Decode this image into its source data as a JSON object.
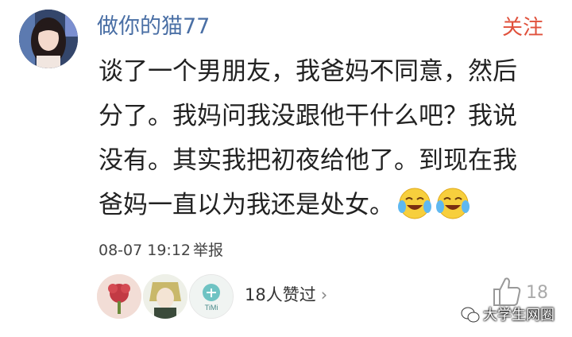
{
  "comment": {
    "username": "做你的猫77",
    "follow_label": "关注",
    "text_lines": [
      "谈了一个男朋友，我爸妈不同意，然后",
      "分了。我妈问我没跟他干什么吧？我说",
      "没有。其实我把初夜给他了。到现在我",
      "爸妈一直以为我还是处女。"
    ],
    "emojis": [
      "laughing-crying-emoji",
      "laughing-crying-emoji"
    ],
    "timestamp": "08-07 19:12",
    "report_label": "举报"
  },
  "likes": {
    "summary": "18人赞过",
    "chevron": "›",
    "count": "18",
    "avatar_3_text": "TiMi"
  },
  "watermark": {
    "text": "大学生网圈"
  },
  "colors": {
    "username": "#4a6fa5",
    "follow": "#e0513c",
    "body_text": "#222222",
    "muted": "#aaaaaa"
  }
}
